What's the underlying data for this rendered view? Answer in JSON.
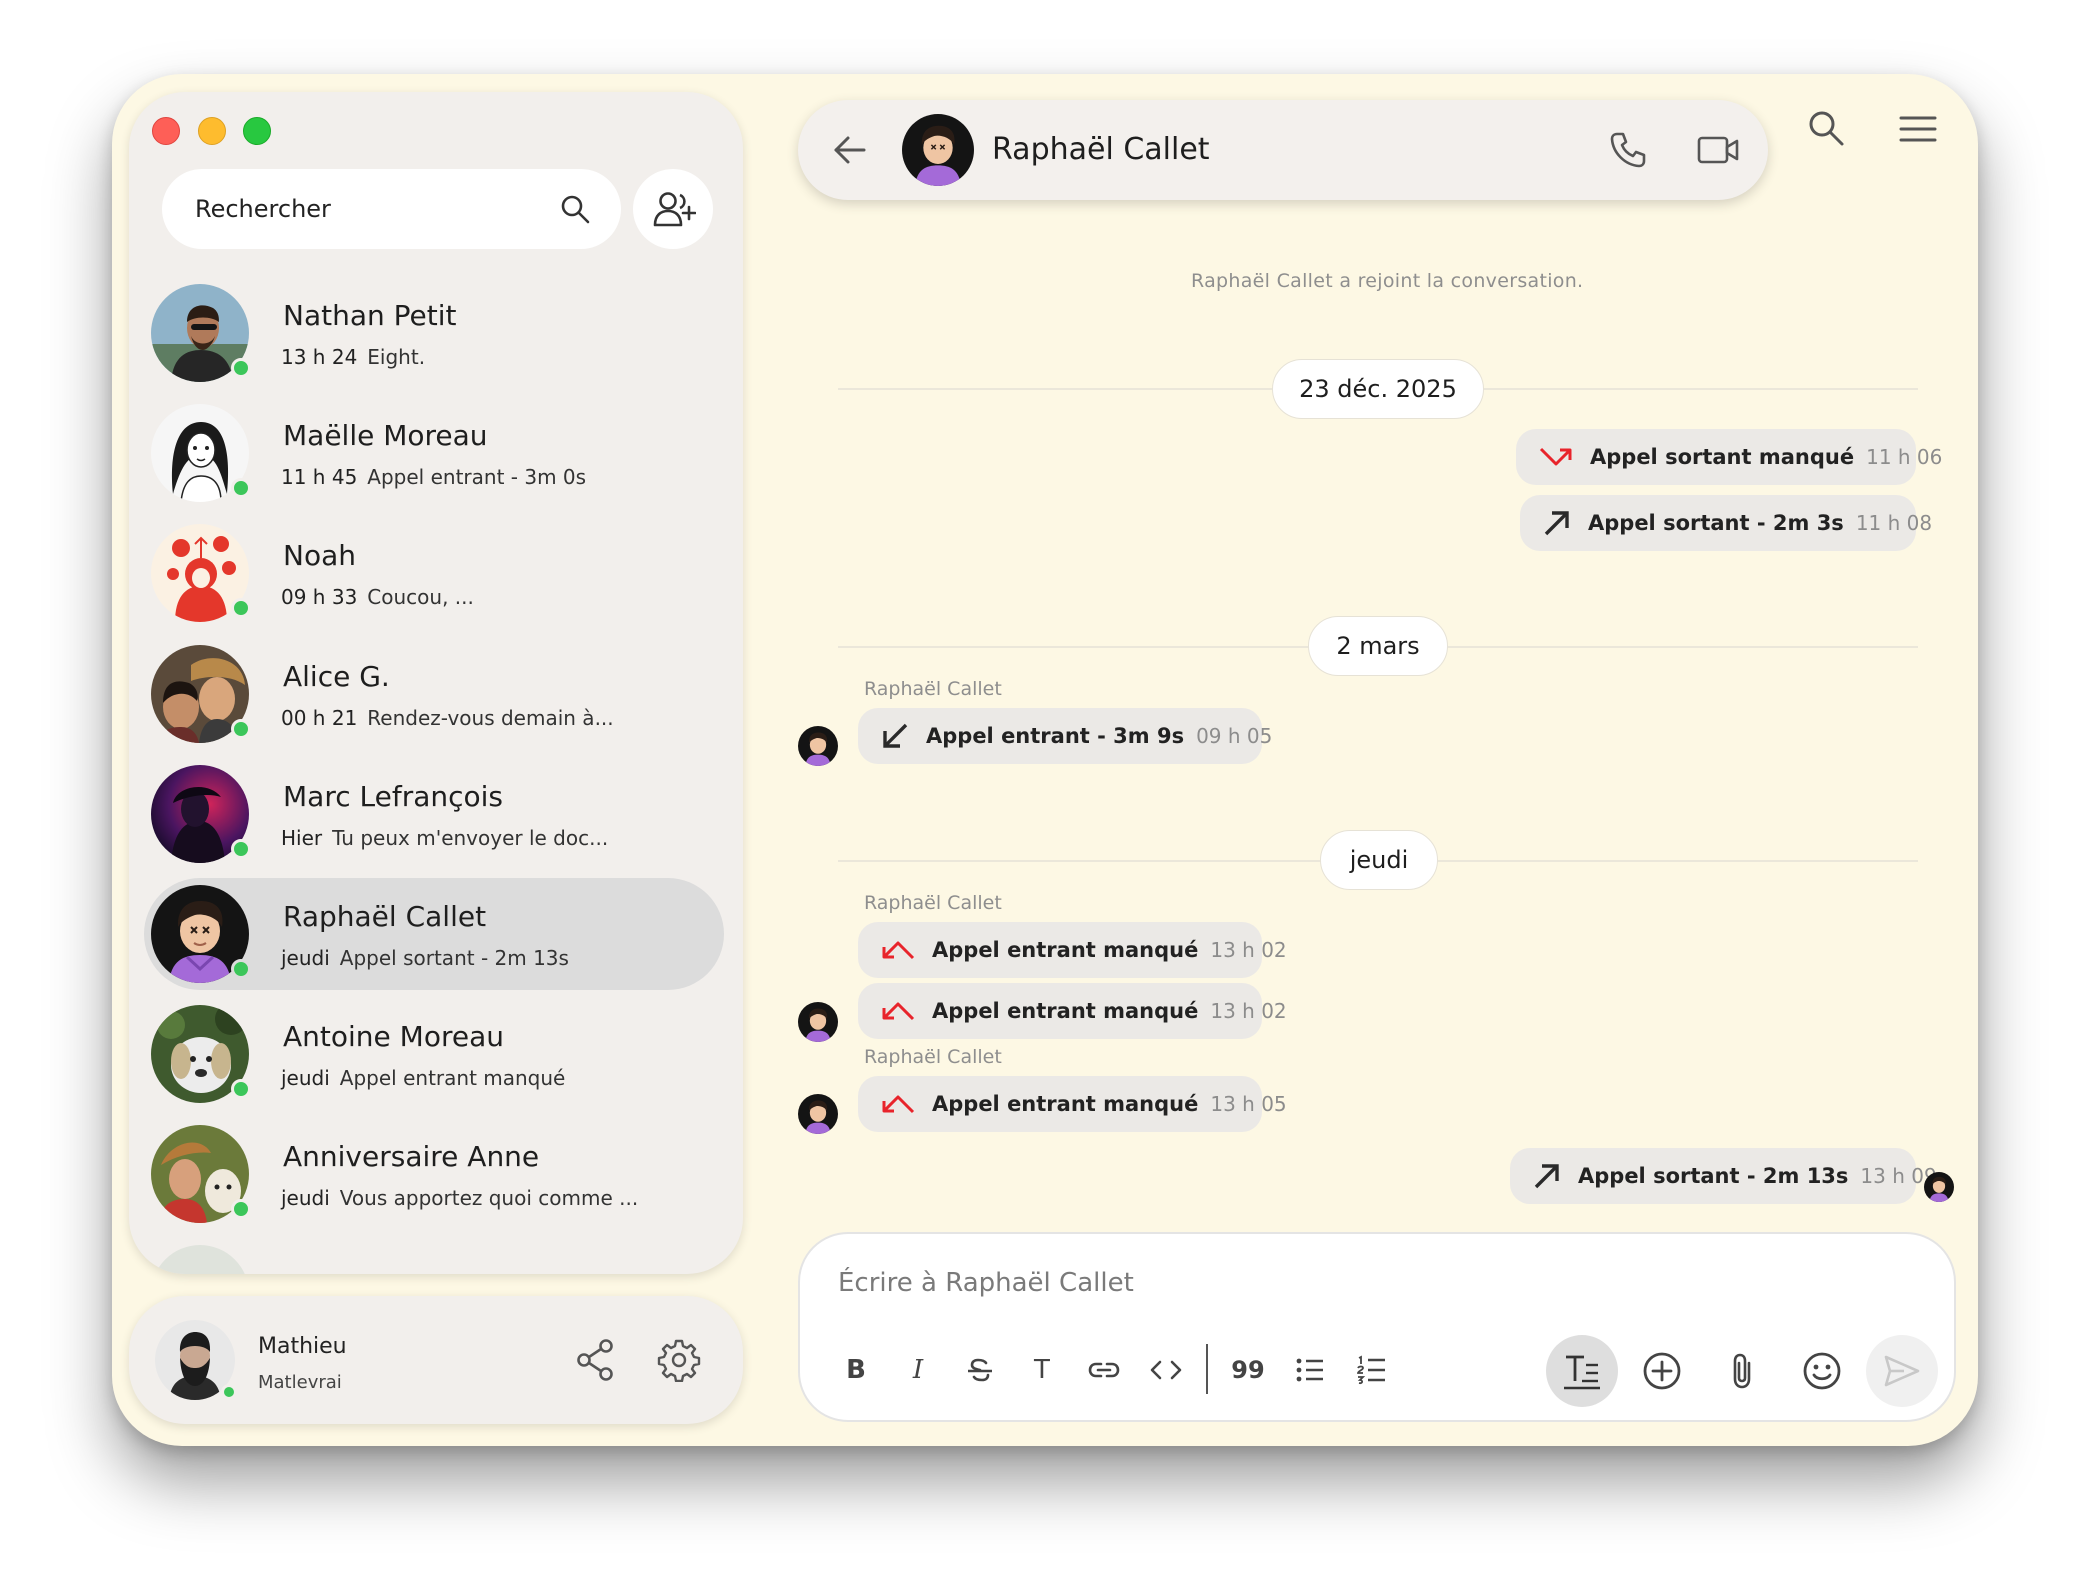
{
  "search": {
    "placeholder": "Rechercher"
  },
  "contacts": [
    {
      "name": "Nathan Petit",
      "time": "13 h 24",
      "preview": "Eight."
    },
    {
      "name": "Maëlle Moreau",
      "time": "11 h 45",
      "preview": "Appel entrant - 3m 0s"
    },
    {
      "name": "Noah",
      "time": "09 h 33",
      "preview": "Coucou, ..."
    },
    {
      "name": "Alice G.",
      "time": "00 h 21",
      "preview": "Rendez-vous demain à..."
    },
    {
      "name": "Marc Lefrançois",
      "time": "Hier",
      "preview": "Tu peux m'envoyer le doc..."
    },
    {
      "name": "Raphaël Callet",
      "time": "jeudi",
      "preview": "Appel sortant - 2m 13s"
    },
    {
      "name": "Antoine Moreau",
      "time": "jeudi",
      "preview": "Appel entrant manqué"
    },
    {
      "name": "Anniversaire Anne",
      "time": "jeudi",
      "preview": "Vous apportez quoi comme ..."
    }
  ],
  "profile": {
    "name": "Mathieu",
    "handle": "Matlevrai"
  },
  "chat": {
    "title": "Raphaël Callet",
    "system_message": "Raphaël Callet a rejoint la conversation.",
    "dates": [
      "23 déc. 2025",
      "2 mars",
      "jeudi"
    ],
    "sender": "Raphaël Callet",
    "messages": [
      {
        "label": "Appel sortant manqué",
        "time": "11 h 06"
      },
      {
        "label": "Appel sortant - 2m 3s",
        "time": "11 h 08"
      },
      {
        "label": "Appel entrant - 3m 9s",
        "time": "09 h 05"
      },
      {
        "label": "Appel entrant manqué",
        "time": "13 h 02"
      },
      {
        "label": "Appel entrant manqué",
        "time": "13 h 02"
      },
      {
        "label": "Appel entrant manqué",
        "time": "13 h 05"
      },
      {
        "label": "Appel sortant - 2m 13s",
        "time": "13 h 09"
      }
    ]
  },
  "composer": {
    "placeholder": "Écrire à Raphaël Callet",
    "toolbar": {
      "bold": "B",
      "italic": "I",
      "strike": "S",
      "text": "T",
      "quote": "99"
    }
  },
  "colors": {
    "missed": "#e8242b",
    "online": "#3cc65a",
    "window_bg": "#fdf8e4"
  }
}
